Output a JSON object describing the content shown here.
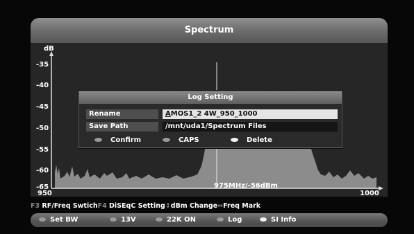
{
  "window": {
    "title": "Spectrum"
  },
  "plot": {
    "y_unit": "dB",
    "y_ticks": [
      "-35",
      "-40",
      "-45",
      "-50",
      "-55",
      "-60",
      "-65"
    ],
    "x_min_label": "950",
    "x_max_label": "1000",
    "marker_readout": "975MHz/-56dBm"
  },
  "dialog": {
    "title": "Log Setting",
    "rename_label": "Rename",
    "rename_value_first": "A",
    "rename_value_rest": "MOS1_2 4W_950_1000",
    "savepath_label": "Save Path",
    "savepath_value": "/mnt/uda1/Spectrum Files",
    "buttons": [
      {
        "label": "Confirm",
        "dot": "gray"
      },
      {
        "label": "CAPS",
        "dot": "gray"
      },
      {
        "label": "Delete",
        "dot": "white"
      }
    ]
  },
  "hints": {
    "f3_key": "F3",
    "f3_text": "RF/Freq Swtich",
    "f4_key": "F4",
    "f4_text": "DiSEqC Setting",
    "updown_icon": "up-down-arrow-icon",
    "updown_text": "dBm Change",
    "leftright_icon": "left-right-arrow-icon",
    "leftright_text": "Freq Mark"
  },
  "bottom_buttons": [
    {
      "label": "Set BW",
      "dot": "gray"
    },
    {
      "label": "13V",
      "dot": "gray"
    },
    {
      "label": "22K ON",
      "dot": "gray"
    },
    {
      "label": "Log",
      "dot": "gray"
    },
    {
      "label": "SI Info",
      "dot": "white"
    }
  ]
}
